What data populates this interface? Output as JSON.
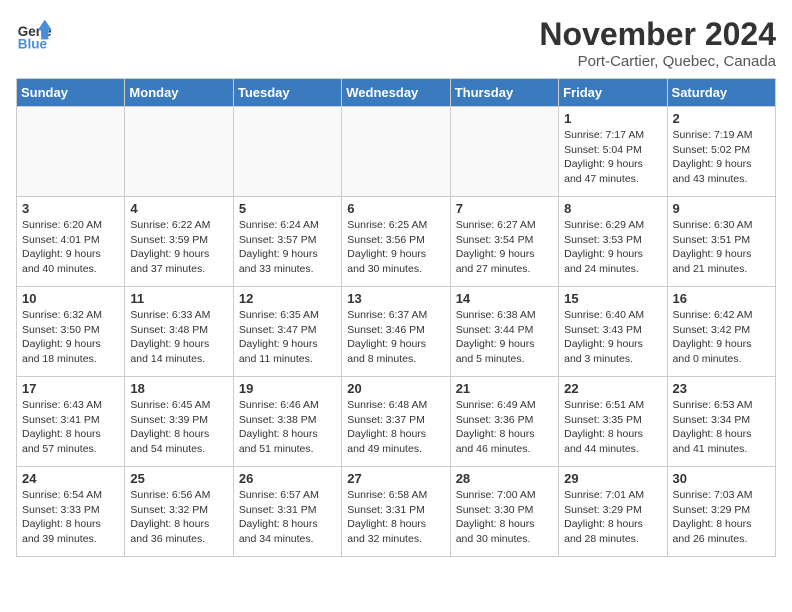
{
  "logo": {
    "line1": "General",
    "line2": "Blue"
  },
  "title": "November 2024",
  "location": "Port-Cartier, Quebec, Canada",
  "days_of_week": [
    "Sunday",
    "Monday",
    "Tuesday",
    "Wednesday",
    "Thursday",
    "Friday",
    "Saturday"
  ],
  "weeks": [
    [
      {
        "num": "",
        "info": ""
      },
      {
        "num": "",
        "info": ""
      },
      {
        "num": "",
        "info": ""
      },
      {
        "num": "",
        "info": ""
      },
      {
        "num": "",
        "info": ""
      },
      {
        "num": "1",
        "info": "Sunrise: 7:17 AM\nSunset: 5:04 PM\nDaylight: 9 hours and 47 minutes."
      },
      {
        "num": "2",
        "info": "Sunrise: 7:19 AM\nSunset: 5:02 PM\nDaylight: 9 hours and 43 minutes."
      }
    ],
    [
      {
        "num": "3",
        "info": "Sunrise: 6:20 AM\nSunset: 4:01 PM\nDaylight: 9 hours and 40 minutes."
      },
      {
        "num": "4",
        "info": "Sunrise: 6:22 AM\nSunset: 3:59 PM\nDaylight: 9 hours and 37 minutes."
      },
      {
        "num": "5",
        "info": "Sunrise: 6:24 AM\nSunset: 3:57 PM\nDaylight: 9 hours and 33 minutes."
      },
      {
        "num": "6",
        "info": "Sunrise: 6:25 AM\nSunset: 3:56 PM\nDaylight: 9 hours and 30 minutes."
      },
      {
        "num": "7",
        "info": "Sunrise: 6:27 AM\nSunset: 3:54 PM\nDaylight: 9 hours and 27 minutes."
      },
      {
        "num": "8",
        "info": "Sunrise: 6:29 AM\nSunset: 3:53 PM\nDaylight: 9 hours and 24 minutes."
      },
      {
        "num": "9",
        "info": "Sunrise: 6:30 AM\nSunset: 3:51 PM\nDaylight: 9 hours and 21 minutes."
      }
    ],
    [
      {
        "num": "10",
        "info": "Sunrise: 6:32 AM\nSunset: 3:50 PM\nDaylight: 9 hours and 18 minutes."
      },
      {
        "num": "11",
        "info": "Sunrise: 6:33 AM\nSunset: 3:48 PM\nDaylight: 9 hours and 14 minutes."
      },
      {
        "num": "12",
        "info": "Sunrise: 6:35 AM\nSunset: 3:47 PM\nDaylight: 9 hours and 11 minutes."
      },
      {
        "num": "13",
        "info": "Sunrise: 6:37 AM\nSunset: 3:46 PM\nDaylight: 9 hours and 8 minutes."
      },
      {
        "num": "14",
        "info": "Sunrise: 6:38 AM\nSunset: 3:44 PM\nDaylight: 9 hours and 5 minutes."
      },
      {
        "num": "15",
        "info": "Sunrise: 6:40 AM\nSunset: 3:43 PM\nDaylight: 9 hours and 3 minutes."
      },
      {
        "num": "16",
        "info": "Sunrise: 6:42 AM\nSunset: 3:42 PM\nDaylight: 9 hours and 0 minutes."
      }
    ],
    [
      {
        "num": "17",
        "info": "Sunrise: 6:43 AM\nSunset: 3:41 PM\nDaylight: 8 hours and 57 minutes."
      },
      {
        "num": "18",
        "info": "Sunrise: 6:45 AM\nSunset: 3:39 PM\nDaylight: 8 hours and 54 minutes."
      },
      {
        "num": "19",
        "info": "Sunrise: 6:46 AM\nSunset: 3:38 PM\nDaylight: 8 hours and 51 minutes."
      },
      {
        "num": "20",
        "info": "Sunrise: 6:48 AM\nSunset: 3:37 PM\nDaylight: 8 hours and 49 minutes."
      },
      {
        "num": "21",
        "info": "Sunrise: 6:49 AM\nSunset: 3:36 PM\nDaylight: 8 hours and 46 minutes."
      },
      {
        "num": "22",
        "info": "Sunrise: 6:51 AM\nSunset: 3:35 PM\nDaylight: 8 hours and 44 minutes."
      },
      {
        "num": "23",
        "info": "Sunrise: 6:53 AM\nSunset: 3:34 PM\nDaylight: 8 hours and 41 minutes."
      }
    ],
    [
      {
        "num": "24",
        "info": "Sunrise: 6:54 AM\nSunset: 3:33 PM\nDaylight: 8 hours and 39 minutes."
      },
      {
        "num": "25",
        "info": "Sunrise: 6:56 AM\nSunset: 3:32 PM\nDaylight: 8 hours and 36 minutes."
      },
      {
        "num": "26",
        "info": "Sunrise: 6:57 AM\nSunset: 3:31 PM\nDaylight: 8 hours and 34 minutes."
      },
      {
        "num": "27",
        "info": "Sunrise: 6:58 AM\nSunset: 3:31 PM\nDaylight: 8 hours and 32 minutes."
      },
      {
        "num": "28",
        "info": "Sunrise: 7:00 AM\nSunset: 3:30 PM\nDaylight: 8 hours and 30 minutes."
      },
      {
        "num": "29",
        "info": "Sunrise: 7:01 AM\nSunset: 3:29 PM\nDaylight: 8 hours and 28 minutes."
      },
      {
        "num": "30",
        "info": "Sunrise: 7:03 AM\nSunset: 3:29 PM\nDaylight: 8 hours and 26 minutes."
      }
    ]
  ]
}
